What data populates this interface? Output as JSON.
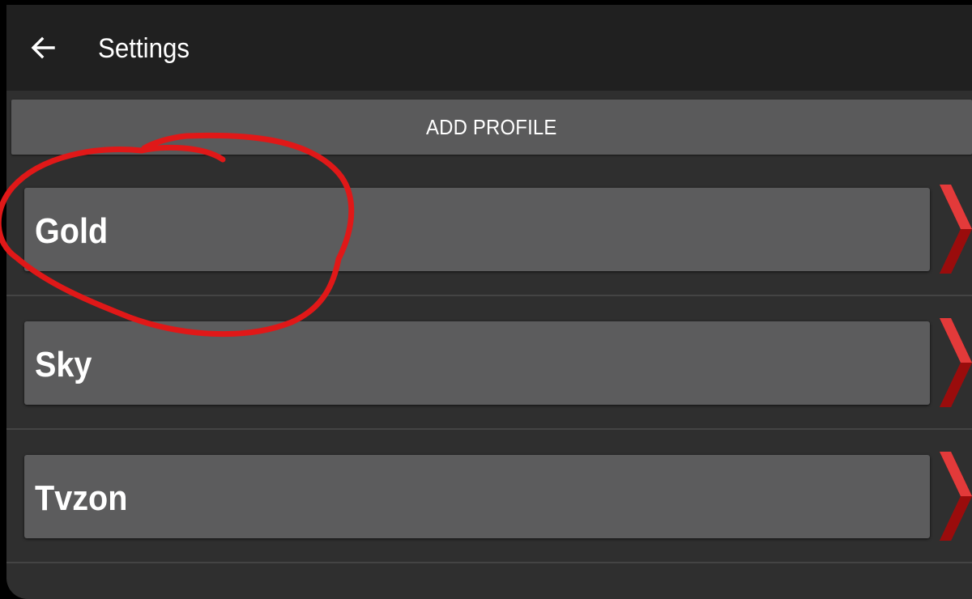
{
  "header": {
    "title": "Settings",
    "back_icon": "arrow-left-icon"
  },
  "actions": {
    "add_profile_label": "ADD PROFILE"
  },
  "profiles": [
    {
      "name": "Gold",
      "chevron_icon": "chevron-right-icon"
    },
    {
      "name": "Sky",
      "chevron_icon": "chevron-right-icon"
    },
    {
      "name": "Tvzon",
      "chevron_icon": "chevron-right-icon"
    }
  ],
  "annotation": {
    "type": "hand-drawn circle",
    "target": "Gold",
    "color": "#e01818"
  },
  "colors": {
    "appbar": "#202020",
    "background": "#2f2f2f",
    "card": "#5c5c5d",
    "chevron": "#d01515"
  }
}
